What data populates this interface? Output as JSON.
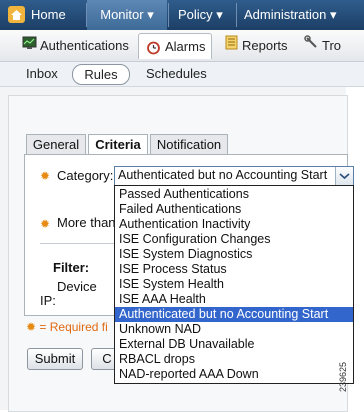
{
  "topnav": {
    "home": "Home",
    "monitor": "Monitor ▾",
    "policy": "Policy ▾",
    "administration": "Administration ▾"
  },
  "subnav": {
    "authentications": "Authentications",
    "alarms": "Alarms",
    "reports": "Reports",
    "troubleshoot": "Tro"
  },
  "thirdnav": {
    "inbox": "Inbox",
    "rules": "Rules",
    "schedules": "Schedules"
  },
  "form": {
    "tabs": [
      "General",
      "Criteria",
      "Notification"
    ],
    "category_label": "Category:",
    "category_value": "Authenticated but no Accounting Start",
    "more_than_label": "More than",
    "filter_label": "Filter:",
    "device_label": "Device",
    "ip_label": "IP:",
    "required_note": "= Required fi",
    "submit": "Submit",
    "cancel": "C"
  },
  "dropdown": {
    "options": [
      "Passed Authentications",
      "Failed Authentications",
      "Authentication Inactivity",
      "ISE Configuration Changes",
      "ISE System Diagnostics",
      "ISE Process Status",
      "ISE System Health",
      "ISE AAA Health",
      "Authenticated but no Accounting Start",
      "Unknown NAD",
      "External DB Unavailable",
      "RBACL drops",
      "NAD-reported AAA Down"
    ],
    "selected_index": 8
  },
  "figure_id": "239625",
  "colors": {
    "nav_bg": "#1c3f66",
    "accent_selected": "#3366cc",
    "required_star": "#e78a14"
  }
}
